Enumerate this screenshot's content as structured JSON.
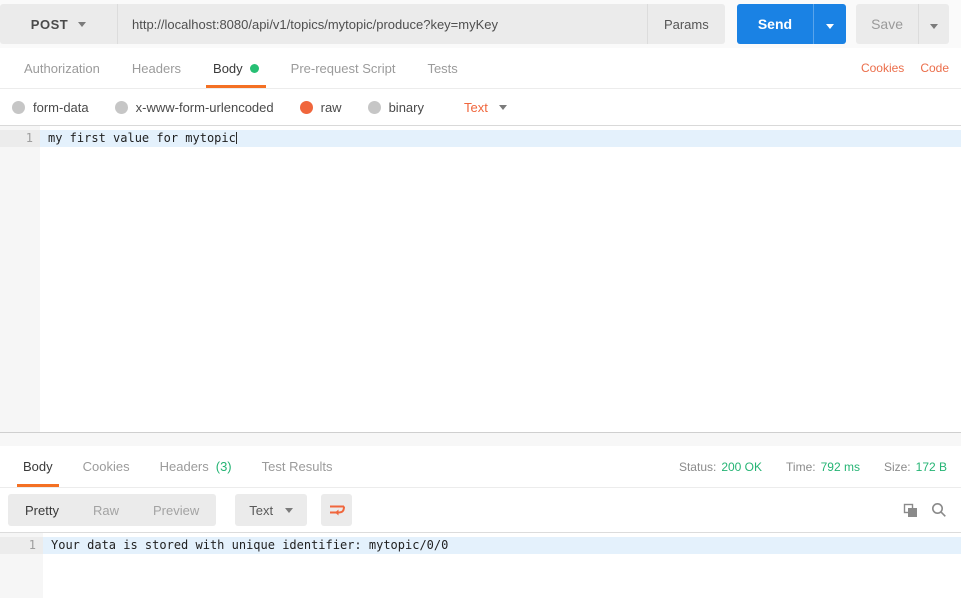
{
  "colors": {
    "accent_orange": "#f0663c",
    "tab_underline_orange": "#f47023",
    "send_blue": "#1a82e4",
    "success_green": "#25b474"
  },
  "request_bar": {
    "method": "POST",
    "url": "http://localhost:8080/api/v1/topics/mytopic/produce?key=myKey",
    "params_label": "Params",
    "send_label": "Send",
    "save_label": "Save"
  },
  "request_tabs": {
    "authorization": "Authorization",
    "headers": "Headers",
    "body": "Body",
    "pre_request_script": "Pre-request Script",
    "tests": "Tests",
    "cookies_link": "Cookies",
    "code_link": "Code"
  },
  "body_type": {
    "form_data": "form-data",
    "urlencoded": "x-www-form-urlencoded",
    "raw": "raw",
    "binary": "binary",
    "selected": "raw",
    "format": "Text"
  },
  "request_editor": {
    "line_number": "1",
    "line1": "my first value for mytopic"
  },
  "response": {
    "tabs": {
      "body": "Body",
      "cookies": "Cookies",
      "headers": "Headers",
      "headers_count": "(3)",
      "test_results": "Test Results"
    },
    "meta": {
      "status_label": "Status:",
      "status_value": "200 OK",
      "time_label": "Time:",
      "time_value": "792 ms",
      "size_label": "Size:",
      "size_value": "172 B"
    },
    "toolbar": {
      "pretty": "Pretty",
      "raw": "Raw",
      "preview": "Preview",
      "format": "Text"
    },
    "editor": {
      "line_number": "1",
      "line1": "Your data is stored with unique identifier: mytopic/0/0"
    }
  },
  "icons": {
    "method_dropdown": "chevron-down-icon",
    "send_dropdown": "chevron-down-icon",
    "save_dropdown": "chevron-down-icon",
    "format_dropdown": "chevron-down-icon",
    "wrap": "wrap-text-icon",
    "copy": "copy-icon",
    "search": "search-icon",
    "body_tab_dot": "green-dot-icon"
  }
}
